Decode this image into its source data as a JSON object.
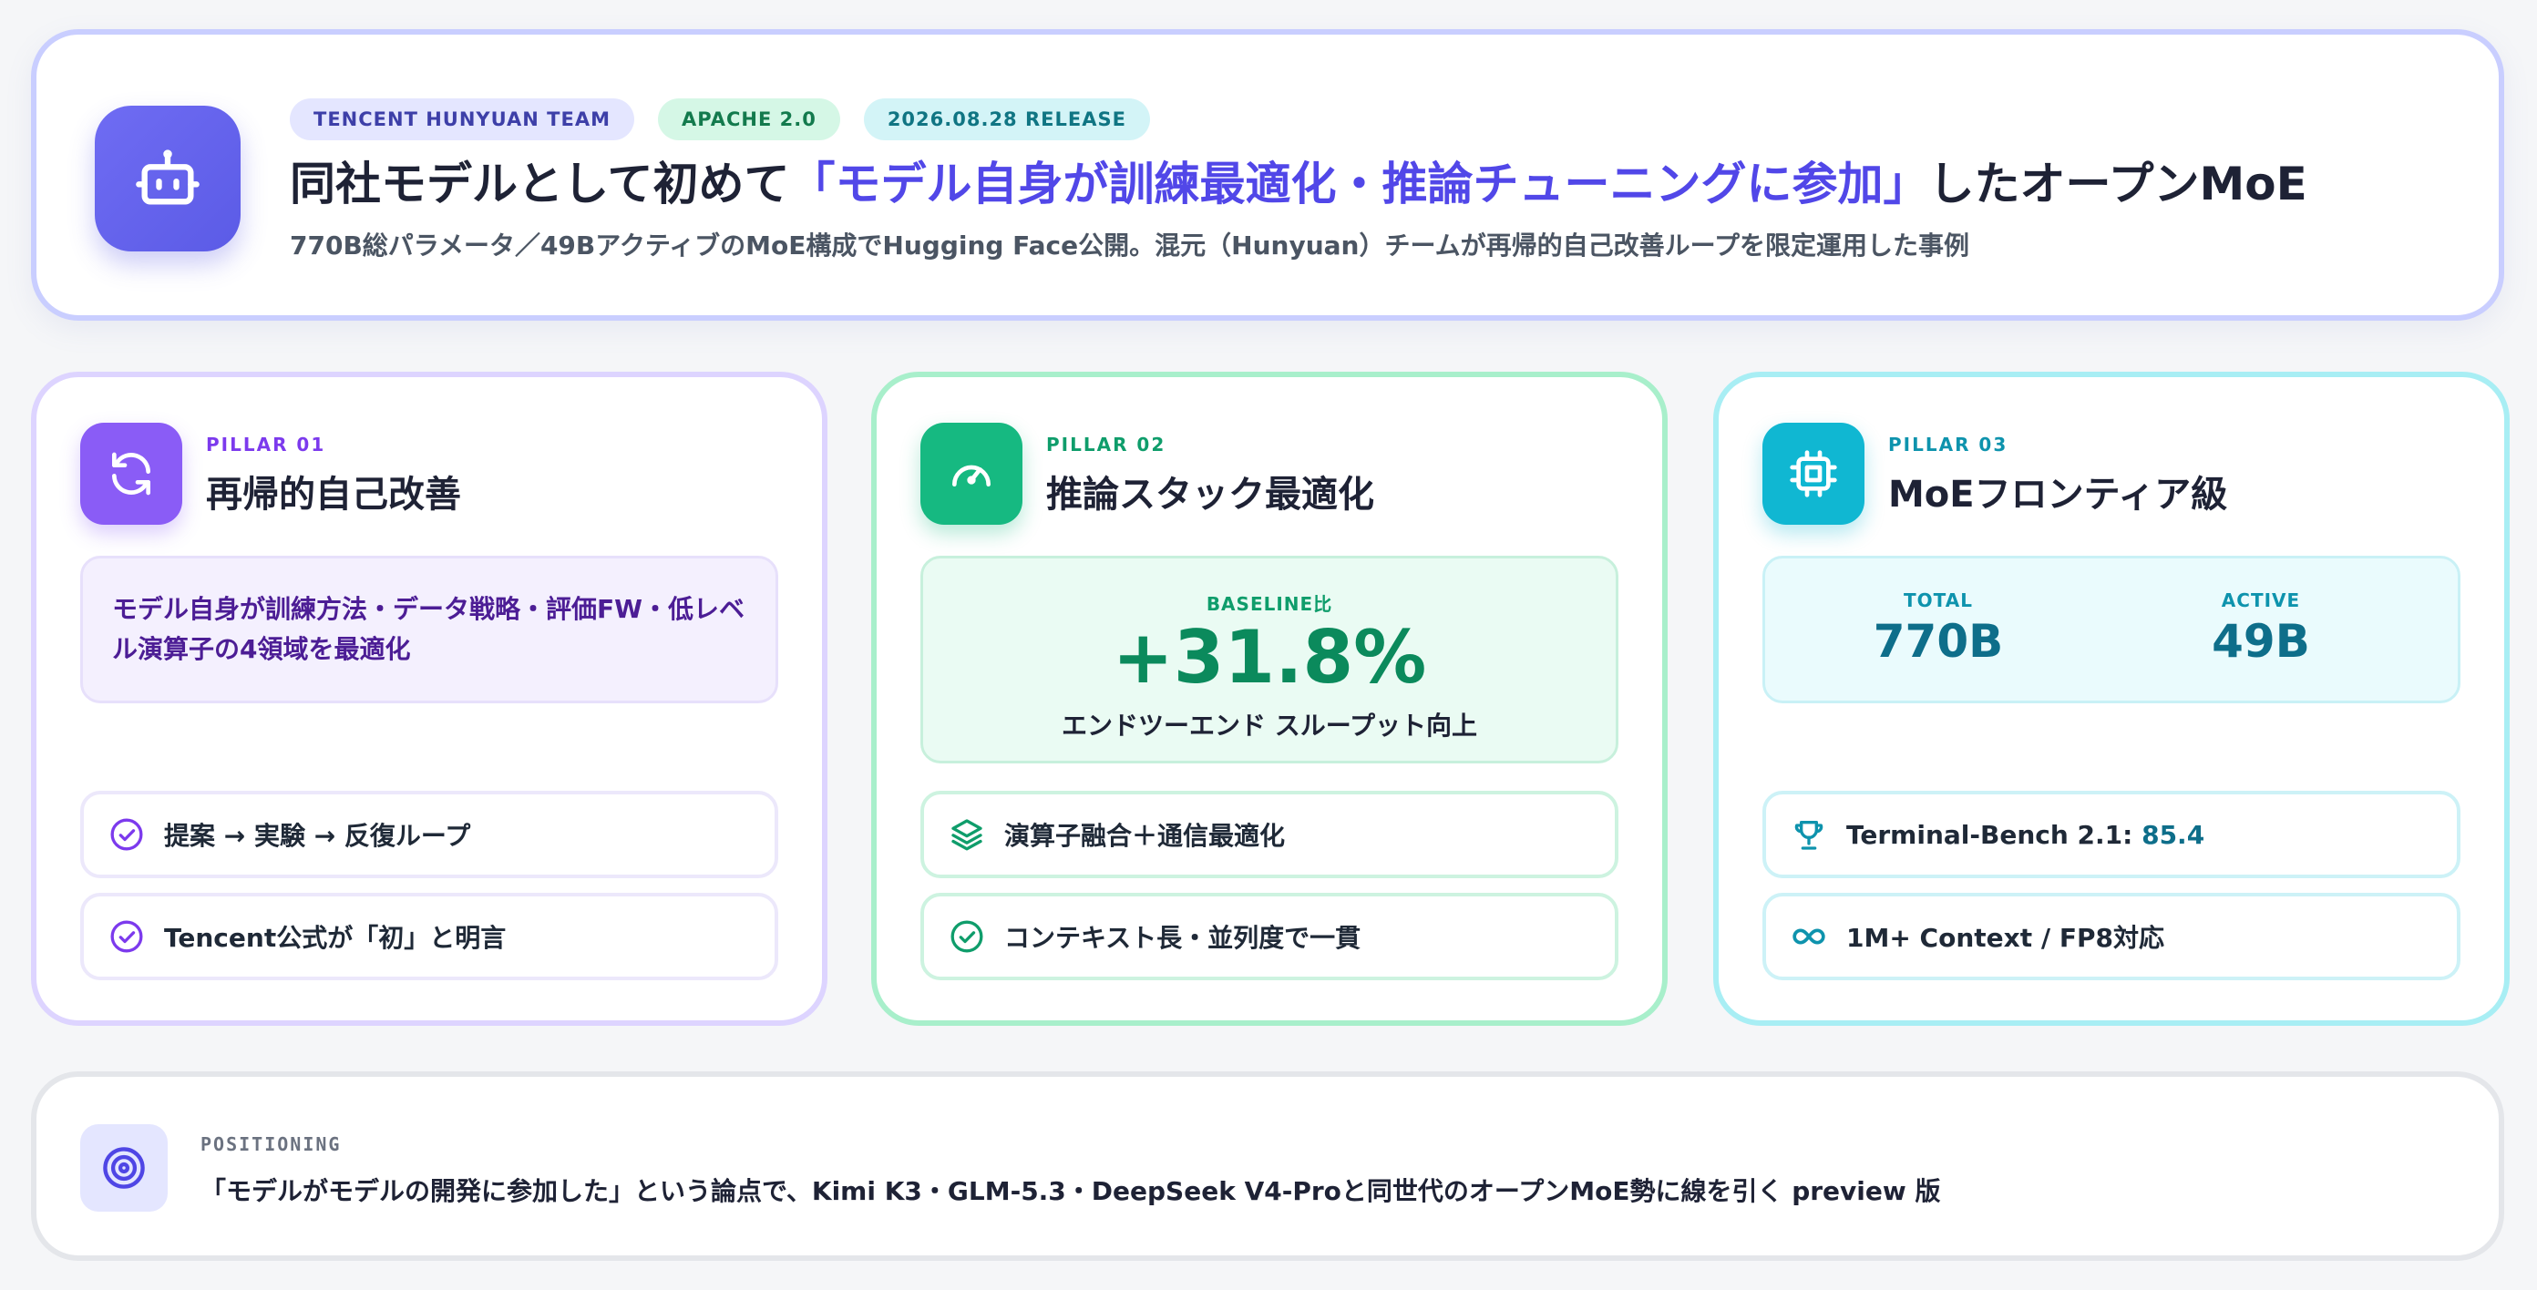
{
  "header": {
    "badges": [
      "TENCENT HUNYUAN TEAM",
      "APACHE 2.0",
      "2026.08.28 RELEASE"
    ],
    "title_prefix": "同社モデルとして初めて",
    "title_accent": "「モデル自身が訓練最適化・推論チューニングに参加」",
    "title_suffix": "したオープンMoE",
    "subtitle": "770B総パラメータ／49BアクティブのMoE構成でHugging Face公開。混元（Hunyuan）チームが再帰的自己改善ループを限定運用した事例",
    "logo_icon": "robot-icon"
  },
  "pillars": [
    {
      "label": "PILLAR 01",
      "title": "再帰的自己改善",
      "icon": "refresh-icon",
      "box_text": "モデル自身が訓練方法・データ戦略・評価FW・低レベル演算子の4領域を最適化",
      "items": [
        {
          "icon": "check-circle-icon",
          "text": "提案 → 実験 → 反復ループ"
        },
        {
          "icon": "check-circle-icon",
          "text": "Tencent公式が「初」と明言"
        }
      ]
    },
    {
      "label": "PILLAR 02",
      "title": "推論スタック最適化",
      "icon": "gauge-icon",
      "kicker": "BASELINE比",
      "big_value": "+31.8%",
      "caption": "エンドツーエンド スループット向上",
      "items": [
        {
          "icon": "layers-icon",
          "text": "演算子融合＋通信最適化"
        },
        {
          "icon": "check-circle-icon",
          "text": "コンテキスト長・並列度で一貫"
        }
      ]
    },
    {
      "label": "PILLAR 03",
      "title": "MoEフロンティア級",
      "icon": "chip-icon",
      "stats": [
        {
          "label": "TOTAL",
          "value": "770B"
        },
        {
          "label": "ACTIVE",
          "value": "49B"
        }
      ],
      "items": [
        {
          "icon": "trophy-icon",
          "text": "Terminal-Bench 2.1: ",
          "highlight": "85.4"
        },
        {
          "icon": "infinity-icon",
          "text": "1M+ Context / FP8対応"
        }
      ]
    }
  ],
  "positioning": {
    "label": "POSITIONING",
    "text": "「モデルがモデルの開発に参加した」という論点で、Kimi K3・GLM-5.3・DeepSeek V4-Proと同世代のオープンMoE勢に線を引く preview 版",
    "icon": "target-icon"
  },
  "colors": {
    "accent": "#5147e8",
    "pillar1": "#8a5cf6",
    "pillar2": "#16b981",
    "pillar3": "#10b7d2"
  }
}
